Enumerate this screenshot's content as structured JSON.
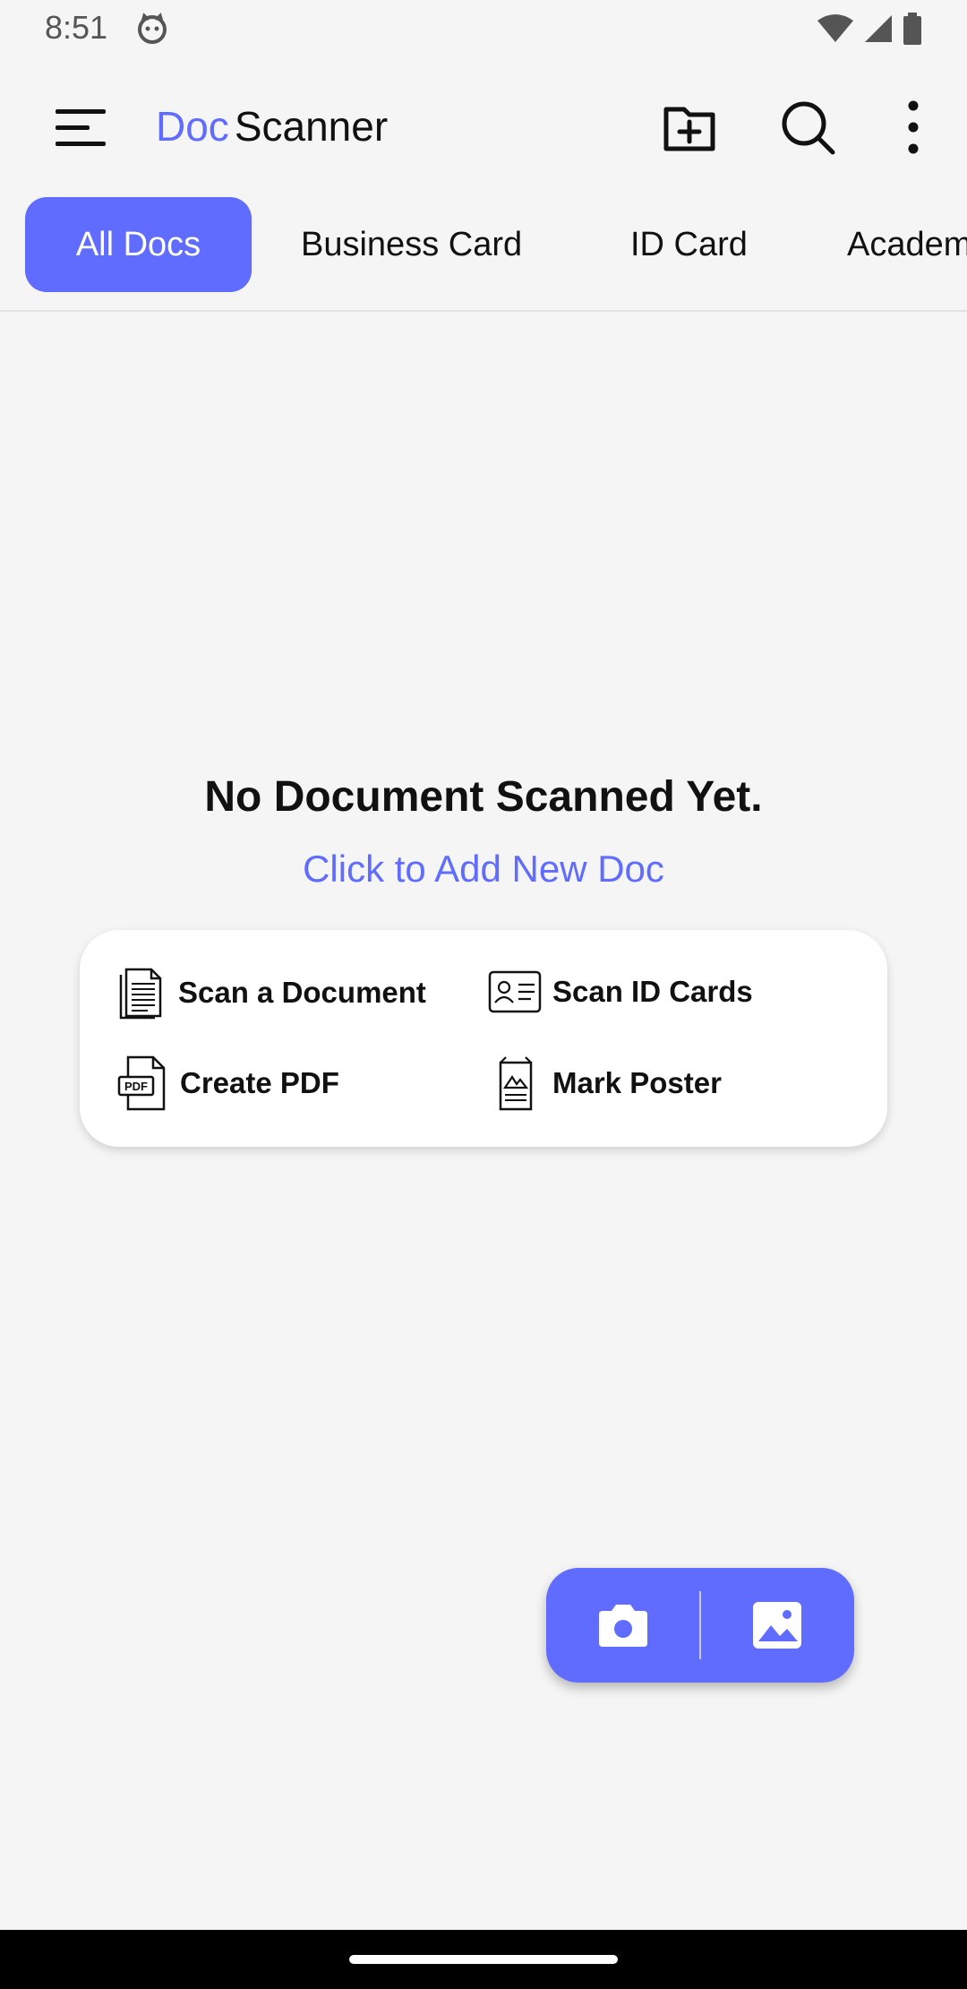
{
  "status_bar": {
    "time": "8:51"
  },
  "app_bar": {
    "title_part1": "Doc",
    "title_part2": "Scanner"
  },
  "tabs": [
    {
      "label": "All Docs"
    },
    {
      "label": "Business Card"
    },
    {
      "label": "ID Card"
    },
    {
      "label": "Academic"
    }
  ],
  "empty_state": {
    "title": "No Document Scanned Yet.",
    "link": "Click to Add New Doc"
  },
  "actions": {
    "scan_document": "Scan a Document",
    "scan_id_cards": "Scan ID Cards",
    "create_pdf": "Create PDF",
    "pdf_icon_text": "PDF",
    "mark_poster": "Mark Poster"
  },
  "colors": {
    "accent": "#5f6cfd",
    "background": "#f5f5f5"
  },
  "icons": [
    "menu-icon",
    "new-folder-icon",
    "search-icon",
    "more-vert-icon",
    "camera-icon",
    "gallery-icon"
  ]
}
